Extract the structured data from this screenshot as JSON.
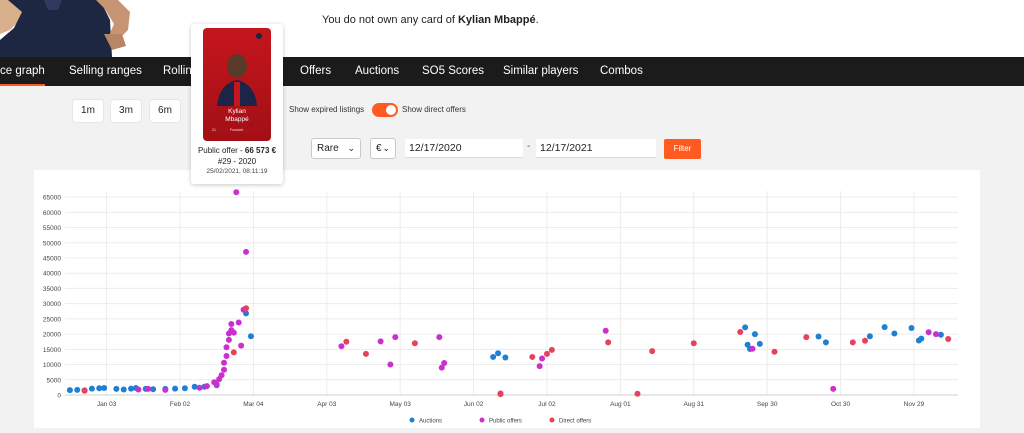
{
  "header": {
    "ownership_prefix": "You do not own any card of ",
    "player_name": "Kylian Mbappé",
    "ownership_suffix": "."
  },
  "tabs": [
    {
      "label": "ce graph",
      "active": true
    },
    {
      "label": "Selling ranges",
      "active": false
    },
    {
      "label": "Rolling",
      "active": false
    },
    {
      "label": "Offers",
      "active": false
    },
    {
      "label": "Auctions",
      "active": false
    },
    {
      "label": "SO5 Scores",
      "active": false
    },
    {
      "label": "Similar players",
      "active": false
    },
    {
      "label": "Combos",
      "active": false
    }
  ],
  "range_buttons": [
    "1m",
    "3m",
    "6m"
  ],
  "toggles": {
    "expired_label": "Show expired listings",
    "direct_label": "Show direct offers",
    "direct_on": true
  },
  "filters": {
    "rarity": "Rare",
    "currency": "€",
    "date_from": "12/17/2020",
    "date_sep": "-",
    "date_to": "12/17/2021",
    "filter_label": "Filter"
  },
  "card_popup": {
    "card_first_name": "Kylian",
    "card_last_name": "Mbappé",
    "card_position": "Forward",
    "card_number": "21",
    "offer_prefix": "Public offer - ",
    "offer_value": "66 573 €",
    "serial": "#29 - 2020",
    "timestamp": "25/02/2021, 08:11:19"
  },
  "colors": {
    "accent": "#ff5a1f",
    "nav_bg": "#1b1b1b",
    "auctions": "#1f7fd6",
    "public_offers": "#cc2fcf",
    "direct_offers": "#e8415b"
  },
  "chart_data": {
    "type": "scatter",
    "x_domain": [
      "2020-12-17",
      "2021-12-17"
    ],
    "ylim": [
      0,
      67000
    ],
    "y_ticks": [
      0,
      5000,
      10000,
      15000,
      20000,
      25000,
      30000,
      35000,
      40000,
      45000,
      50000,
      55000,
      60000,
      65000
    ],
    "x_ticks": [
      {
        "date": "2021-01-03",
        "label": "Jan 03"
      },
      {
        "date": "2021-02-02",
        "label": "Feb 02"
      },
      {
        "date": "2021-03-04",
        "label": "Mar 04"
      },
      {
        "date": "2021-04-03",
        "label": "Apr 03"
      },
      {
        "date": "2021-05-03",
        "label": "May 03"
      },
      {
        "date": "2021-06-02",
        "label": "Jun 02"
      },
      {
        "date": "2021-07-02",
        "label": "Jul 02"
      },
      {
        "date": "2021-08-01",
        "label": "Aug 01"
      },
      {
        "date": "2021-08-31",
        "label": "Aug 31"
      },
      {
        "date": "2021-09-30",
        "label": "Sep 30"
      },
      {
        "date": "2021-10-30",
        "label": "Oct 30"
      },
      {
        "date": "2021-11-29",
        "label": "Nov 29"
      }
    ],
    "grid": true,
    "legend_position": "bottom",
    "series": [
      {
        "name": "Auctions",
        "color": "#1f7fd6",
        "points": [
          [
            "2020-12-19",
            1600
          ],
          [
            "2020-12-22",
            1700
          ],
          [
            "2020-12-25",
            1500
          ],
          [
            "2020-12-28",
            2100
          ],
          [
            "2020-12-31",
            2200
          ],
          [
            "2021-01-02",
            2300
          ],
          [
            "2021-01-07",
            2000
          ],
          [
            "2021-01-10",
            1800
          ],
          [
            "2021-01-13",
            2100
          ],
          [
            "2021-01-15",
            2300
          ],
          [
            "2021-01-19",
            2000
          ],
          [
            "2021-01-22",
            1900
          ],
          [
            "2021-01-27",
            2000
          ],
          [
            "2021-01-31",
            2100
          ],
          [
            "2021-02-04",
            2200
          ],
          [
            "2021-02-08",
            2700
          ],
          [
            "2021-02-12",
            2700
          ],
          [
            "2021-02-17",
            3200
          ],
          [
            "2021-03-01",
            26800
          ],
          [
            "2021-03-03",
            19300
          ],
          [
            "2021-06-10",
            12500
          ],
          [
            "2021-06-12",
            13700
          ],
          [
            "2021-06-15",
            12300
          ],
          [
            "2021-09-21",
            22200
          ],
          [
            "2021-09-22",
            16500
          ],
          [
            "2021-09-23",
            15100
          ],
          [
            "2021-09-25",
            20000
          ],
          [
            "2021-09-27",
            16800
          ],
          [
            "2021-10-21",
            19200
          ],
          [
            "2021-10-24",
            17300
          ],
          [
            "2021-11-11",
            19300
          ],
          [
            "2021-11-17",
            22300
          ],
          [
            "2021-11-21",
            20200
          ],
          [
            "2021-11-28",
            22000
          ],
          [
            "2021-12-01",
            17900
          ],
          [
            "2021-12-02",
            18500
          ],
          [
            "2021-12-10",
            19800
          ]
        ]
      },
      {
        "name": "Public offers",
        "color": "#cc2fcf",
        "points": [
          [
            "2021-01-16",
            1800
          ],
          [
            "2021-01-20",
            2000
          ],
          [
            "2021-01-27",
            1700
          ],
          [
            "2021-02-10",
            2400
          ],
          [
            "2021-02-13",
            2900
          ],
          [
            "2021-02-16",
            4200
          ],
          [
            "2021-02-17",
            3500
          ],
          [
            "2021-02-18",
            5200
          ],
          [
            "2021-02-19",
            6500
          ],
          [
            "2021-02-20",
            8300
          ],
          [
            "2021-02-20",
            10600
          ],
          [
            "2021-02-21",
            12800
          ],
          [
            "2021-02-21",
            15700
          ],
          [
            "2021-02-22",
            18100
          ],
          [
            "2021-02-22",
            20200
          ],
          [
            "2021-02-23",
            21300
          ],
          [
            "2021-02-23",
            23300
          ],
          [
            "2021-02-24",
            20500
          ],
          [
            "2021-02-25",
            66573
          ],
          [
            "2021-02-26",
            23800
          ],
          [
            "2021-02-27",
            16200
          ],
          [
            "2021-02-28",
            28000
          ],
          [
            "2021-03-01",
            47000
          ],
          [
            "2021-04-09",
            16000
          ],
          [
            "2021-04-25",
            17600
          ],
          [
            "2021-04-29",
            10000
          ],
          [
            "2021-05-01",
            19000
          ],
          [
            "2021-05-19",
            19000
          ],
          [
            "2021-05-20",
            9000
          ],
          [
            "2021-05-21",
            10500
          ],
          [
            "2021-06-13",
            500
          ],
          [
            "2021-06-29",
            9500
          ],
          [
            "2021-06-30",
            12000
          ],
          [
            "2021-07-26",
            21100
          ],
          [
            "2021-09-24",
            15200
          ],
          [
            "2021-10-27",
            2000
          ],
          [
            "2021-12-05",
            20600
          ],
          [
            "2021-12-08",
            20000
          ]
        ]
      },
      {
        "name": "Direct offers",
        "color": "#e8415b",
        "points": [
          [
            "2020-12-25",
            1400
          ],
          [
            "2021-02-24",
            14000
          ],
          [
            "2021-03-01",
            28500
          ],
          [
            "2021-04-11",
            17500
          ],
          [
            "2021-04-19",
            13500
          ],
          [
            "2021-05-09",
            17000
          ],
          [
            "2021-06-13",
            300
          ],
          [
            "2021-06-26",
            12500
          ],
          [
            "2021-07-02",
            13500
          ],
          [
            "2021-07-04",
            14800
          ],
          [
            "2021-07-27",
            17300
          ],
          [
            "2021-08-08",
            400
          ],
          [
            "2021-08-14",
            14400
          ],
          [
            "2021-08-31",
            17000
          ],
          [
            "2021-09-19",
            20700
          ],
          [
            "2021-10-03",
            14200
          ],
          [
            "2021-10-16",
            19000
          ],
          [
            "2021-11-04",
            17300
          ],
          [
            "2021-11-09",
            17800
          ],
          [
            "2021-12-13",
            18400
          ]
        ]
      }
    ]
  }
}
